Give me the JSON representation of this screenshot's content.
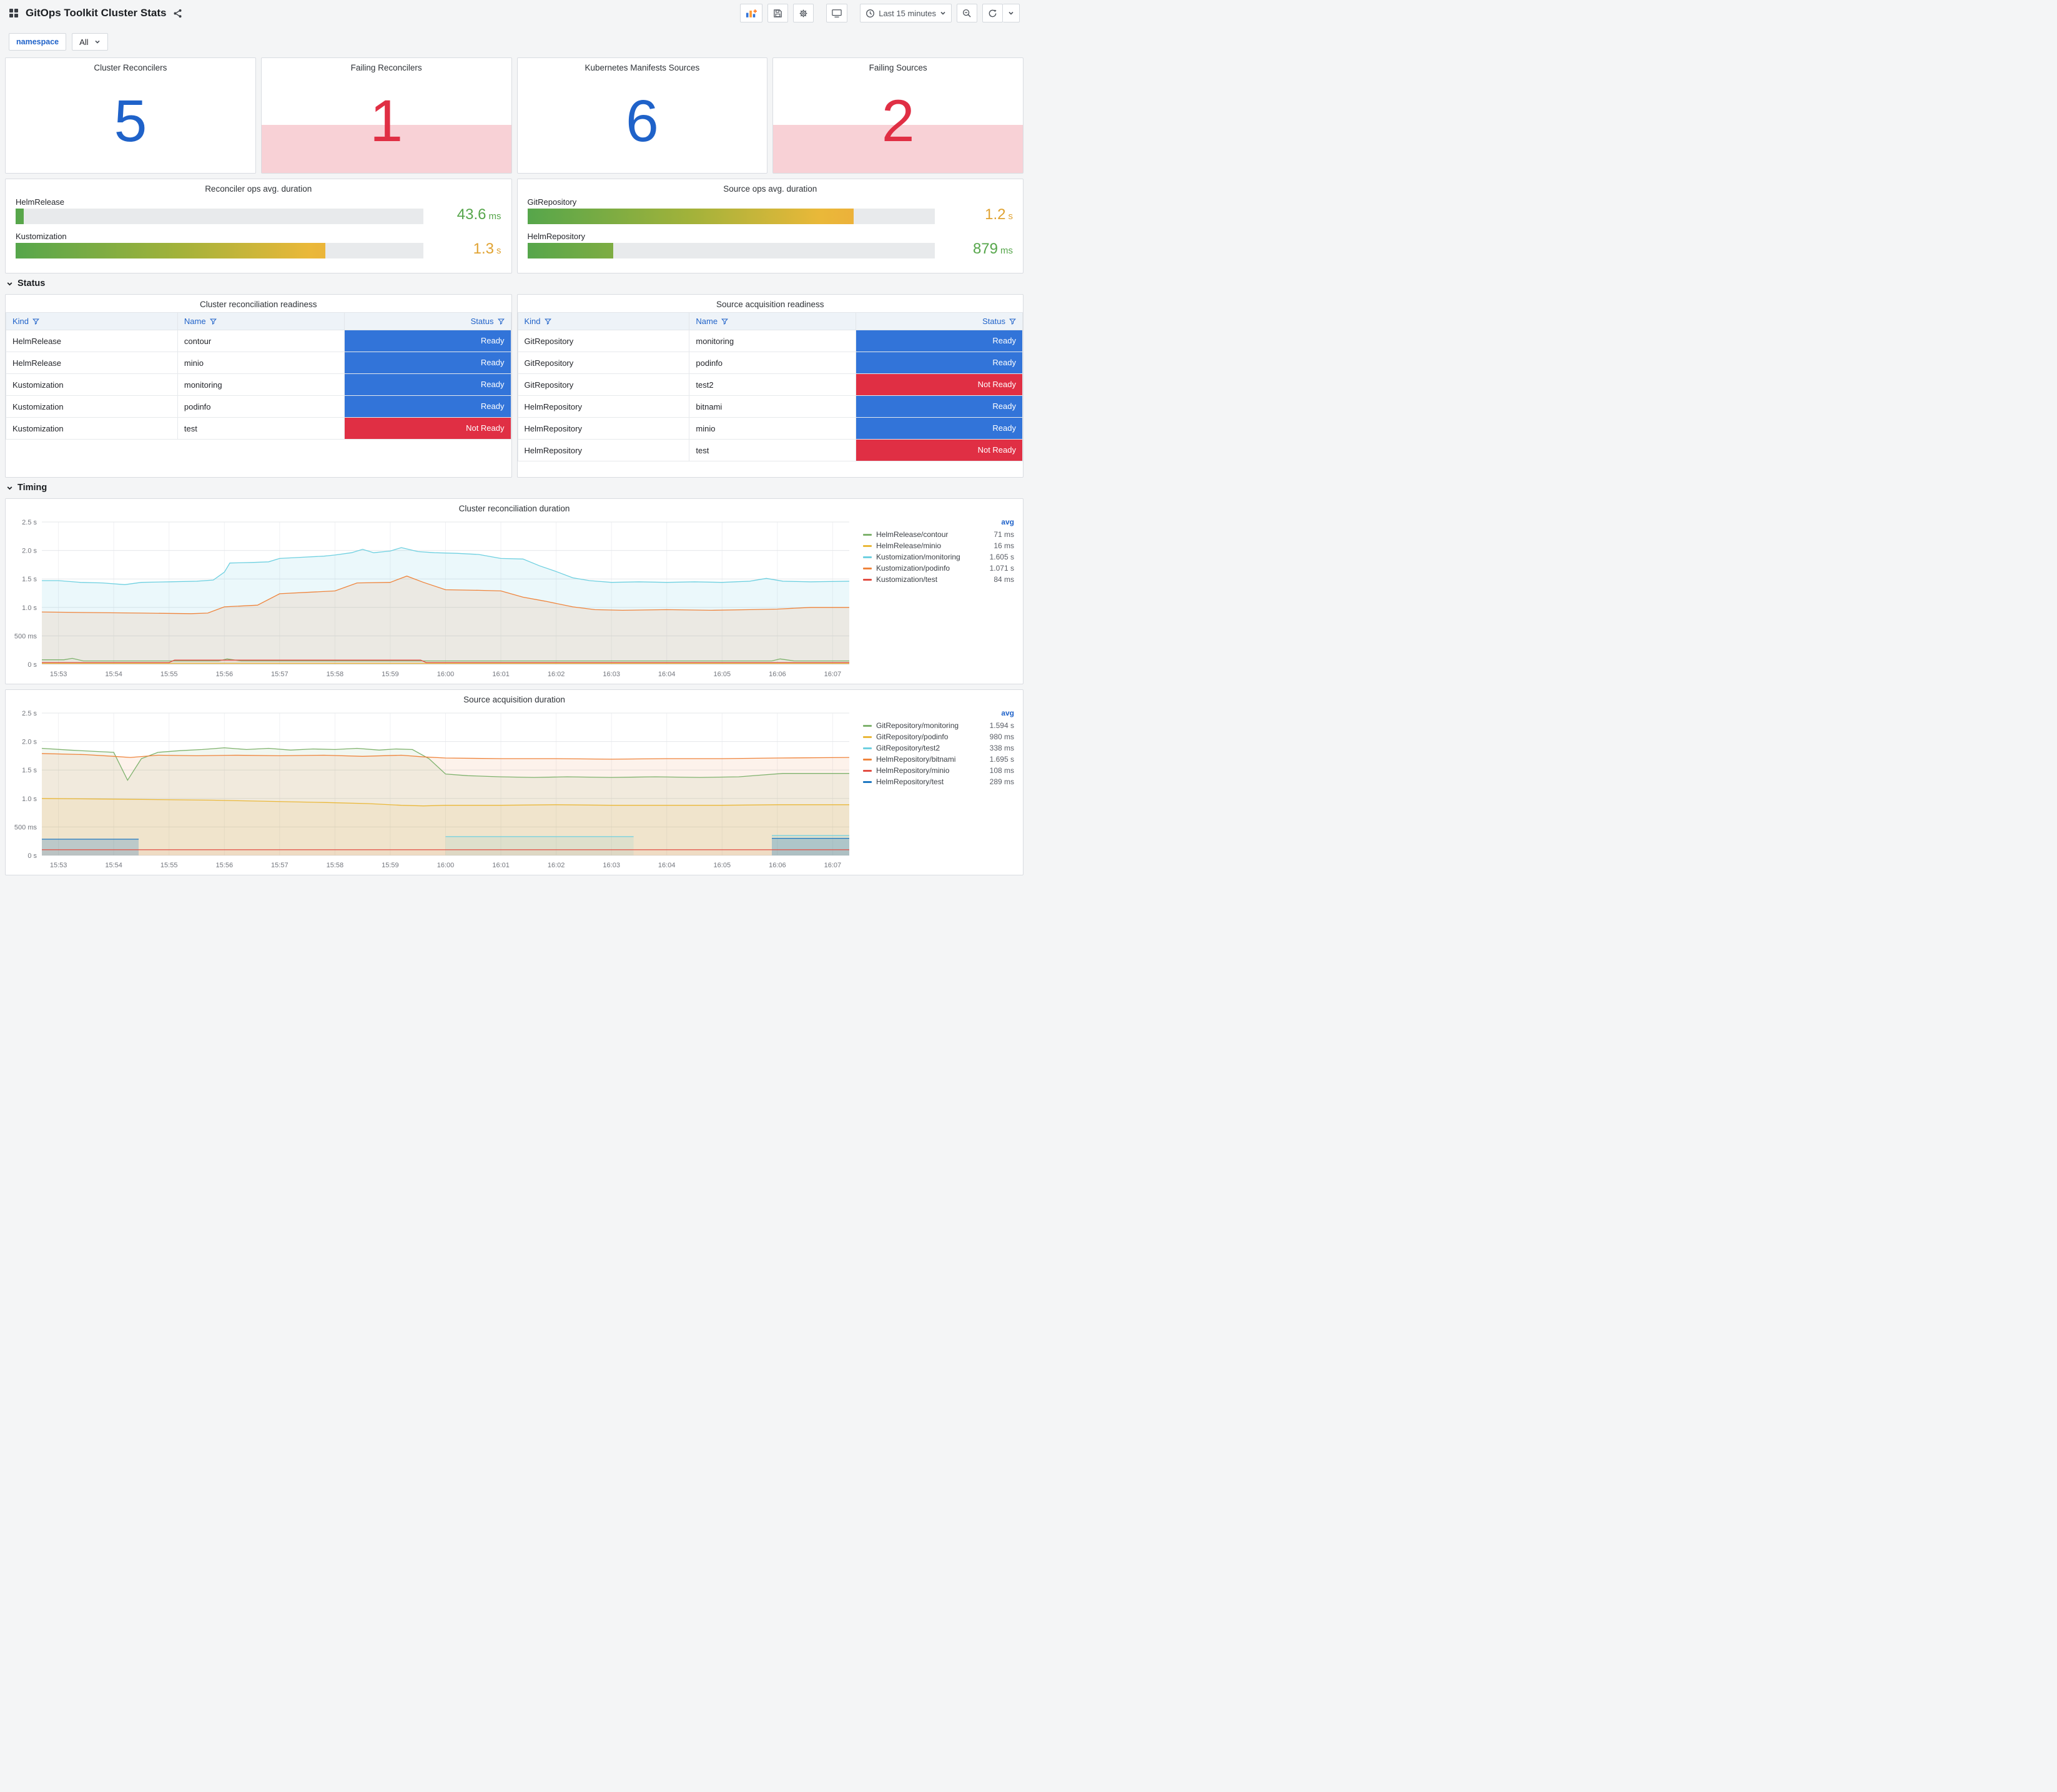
{
  "nav": {
    "title": "GitOps Toolkit Cluster Stats",
    "time_picker": "Last 15 minutes"
  },
  "variables": {
    "label": "namespace",
    "value": "All"
  },
  "sections": {
    "status": "Status",
    "timing": "Timing"
  },
  "stats": [
    {
      "title": "Cluster Reconcilers",
      "value": "5",
      "state": "ok"
    },
    {
      "title": "Failing Reconcilers",
      "value": "1",
      "state": "alert"
    },
    {
      "title": "Kubernetes Manifests Sources",
      "value": "6",
      "state": "ok"
    },
    {
      "title": "Failing Sources",
      "value": "2",
      "state": "alert"
    }
  ],
  "gauge_panels": [
    {
      "title": "Reconciler ops avg. duration",
      "rows": [
        {
          "label": "HelmRelease",
          "value": "43.6",
          "unit": "ms",
          "pct": 2,
          "value_color": "#56a64b"
        },
        {
          "label": "Kustomization",
          "value": "1.3",
          "unit": "s",
          "pct": 76,
          "value_color": "#e0a231"
        }
      ]
    },
    {
      "title": "Source ops avg. duration",
      "rows": [
        {
          "label": "GitRepository",
          "value": "1.2",
          "unit": "s",
          "pct": 80,
          "value_color": "#e0a231"
        },
        {
          "label": "HelmRepository",
          "value": "879",
          "unit": "ms",
          "pct": 21,
          "value_color": "#56a64b"
        }
      ]
    }
  ],
  "tables": [
    {
      "title": "Cluster reconciliation readiness",
      "headers": [
        "Kind",
        "Name",
        "Status"
      ],
      "rows": [
        {
          "kind": "HelmRelease",
          "name": "contour",
          "status": "Ready"
        },
        {
          "kind": "HelmRelease",
          "name": "minio",
          "status": "Ready"
        },
        {
          "kind": "Kustomization",
          "name": "monitoring",
          "status": "Ready"
        },
        {
          "kind": "Kustomization",
          "name": "podinfo",
          "status": "Ready"
        },
        {
          "kind": "Kustomization",
          "name": "test",
          "status": "Not Ready"
        }
      ]
    },
    {
      "title": "Source acquisition readiness",
      "headers": [
        "Kind",
        "Name",
        "Status"
      ],
      "rows": [
        {
          "kind": "GitRepository",
          "name": "monitoring",
          "status": "Ready"
        },
        {
          "kind": "GitRepository",
          "name": "podinfo",
          "status": "Ready"
        },
        {
          "kind": "GitRepository",
          "name": "test2",
          "status": "Not Ready"
        },
        {
          "kind": "HelmRepository",
          "name": "bitnami",
          "status": "Ready"
        },
        {
          "kind": "HelmRepository",
          "name": "minio",
          "status": "Ready"
        },
        {
          "kind": "HelmRepository",
          "name": "test",
          "status": "Not Ready"
        }
      ]
    }
  ],
  "chart_data": [
    {
      "type": "line",
      "title": "Cluster reconciliation duration",
      "x_ticks": [
        "15:53",
        "15:54",
        "15:55",
        "15:56",
        "15:57",
        "15:58",
        "15:59",
        "16:00",
        "16:01",
        "16:02",
        "16:03",
        "16:04",
        "16:05",
        "16:06",
        "16:07"
      ],
      "x_range": [
        -0.3,
        14.3
      ],
      "ylim": [
        0,
        2.5
      ],
      "y_ticks": [
        {
          "v": 0,
          "label": "0 s"
        },
        {
          "v": 0.5,
          "label": "500 ms"
        },
        {
          "v": 1,
          "label": "1.0 s"
        },
        {
          "v": 1.5,
          "label": "1.5 s"
        },
        {
          "v": 2,
          "label": "2.0 s"
        },
        {
          "v": 2.5,
          "label": "2.5 s"
        }
      ],
      "legend_header": "avg",
      "grid": true,
      "legend_position": "right",
      "series": [
        {
          "name": "HelmRelease/contour",
          "avg": "71 ms",
          "color": "#7EB26D",
          "fill": 0.05,
          "points": [
            [
              -0.3,
              0.08
            ],
            [
              0.1,
              0.08
            ],
            [
              0.25,
              0.105
            ],
            [
              0.45,
              0.06
            ],
            [
              1,
              0.06
            ],
            [
              2,
              0.06
            ],
            [
              2.9,
              0.06
            ],
            [
              3.05,
              0.095
            ],
            [
              3.3,
              0.06
            ],
            [
              4,
              0.06
            ],
            [
              5,
              0.06
            ],
            [
              6,
              0.06
            ],
            [
              7,
              0.06
            ],
            [
              8,
              0.06
            ],
            [
              9,
              0.06
            ],
            [
              10,
              0.06
            ],
            [
              11,
              0.06
            ],
            [
              12,
              0.06
            ],
            [
              12.9,
              0.06
            ],
            [
              13.05,
              0.095
            ],
            [
              13.3,
              0.06
            ],
            [
              14.3,
              0.06
            ]
          ]
        },
        {
          "name": "HelmRelease/minio",
          "avg": "16 ms",
          "color": "#EAB839",
          "fill": 0.04,
          "points": [
            [
              -0.3,
              0.018
            ],
            [
              14.3,
              0.018
            ]
          ]
        },
        {
          "name": "Kustomization/monitoring",
          "avg": "1.605 s",
          "color": "#6ED0E0",
          "fill": 0.14,
          "points": [
            [
              -0.3,
              1.47
            ],
            [
              0,
              1.47
            ],
            [
              0.4,
              1.44
            ],
            [
              0.8,
              1.43
            ],
            [
              1.2,
              1.4
            ],
            [
              1.5,
              1.44
            ],
            [
              2,
              1.45
            ],
            [
              2.5,
              1.46
            ],
            [
              2.8,
              1.48
            ],
            [
              3,
              1.62
            ],
            [
              3.1,
              1.78
            ],
            [
              3.5,
              1.79
            ],
            [
              3.8,
              1.8
            ],
            [
              4,
              1.86
            ],
            [
              4.4,
              1.88
            ],
            [
              4.8,
              1.9
            ],
            [
              5,
              1.92
            ],
            [
              5.3,
              1.96
            ],
            [
              5.5,
              2.02
            ],
            [
              5.7,
              1.96
            ],
            [
              6,
              1.99
            ],
            [
              6.2,
              2.05
            ],
            [
              6.5,
              1.98
            ],
            [
              6.8,
              1.96
            ],
            [
              7.2,
              1.95
            ],
            [
              7.6,
              1.93
            ],
            [
              8,
              1.86
            ],
            [
              8.4,
              1.85
            ],
            [
              8.7,
              1.73
            ],
            [
              9,
              1.63
            ],
            [
              9.3,
              1.52
            ],
            [
              9.6,
              1.47
            ],
            [
              10,
              1.44
            ],
            [
              10.5,
              1.45
            ],
            [
              11,
              1.44
            ],
            [
              11.5,
              1.45
            ],
            [
              12,
              1.44
            ],
            [
              12.5,
              1.46
            ],
            [
              12.8,
              1.51
            ],
            [
              13.1,
              1.46
            ],
            [
              13.6,
              1.45
            ],
            [
              14.3,
              1.46
            ]
          ]
        },
        {
          "name": "Kustomization/podinfo",
          "avg": "1.071 s",
          "color": "#EF843C",
          "fill": 0.12,
          "points": [
            [
              -0.3,
              0.92
            ],
            [
              0.5,
              0.91
            ],
            [
              1.5,
              0.9
            ],
            [
              2.4,
              0.89
            ],
            [
              2.7,
              0.9
            ],
            [
              3,
              1.01
            ],
            [
              3.6,
              1.04
            ],
            [
              4,
              1.24
            ],
            [
              4.6,
              1.27
            ],
            [
              5,
              1.29
            ],
            [
              5.4,
              1.43
            ],
            [
              6,
              1.44
            ],
            [
              6.3,
              1.55
            ],
            [
              6.6,
              1.44
            ],
            [
              7,
              1.31
            ],
            [
              7.6,
              1.3
            ],
            [
              8,
              1.29
            ],
            [
              8.4,
              1.18
            ],
            [
              8.8,
              1.11
            ],
            [
              9.3,
              1.01
            ],
            [
              9.7,
              0.96
            ],
            [
              10.2,
              0.95
            ],
            [
              11,
              0.96
            ],
            [
              11.8,
              0.95
            ],
            [
              12.5,
              0.96
            ],
            [
              13,
              0.97
            ],
            [
              13.6,
              1.0
            ],
            [
              14.3,
              1.0
            ]
          ]
        },
        {
          "name": "Kustomization/test",
          "avg": "84 ms",
          "color": "#E24D42",
          "fill": 0.05,
          "points": [
            [
              -0.3,
              0.032
            ],
            [
              2,
              0.032
            ],
            [
              2.1,
              0.075
            ],
            [
              6.55,
              0.075
            ],
            [
              6.65,
              0.032
            ],
            [
              14.3,
              0.032
            ]
          ]
        }
      ]
    },
    {
      "type": "line",
      "title": "Source acquisition duration",
      "x_ticks": [
        "15:53",
        "15:54",
        "15:55",
        "15:56",
        "15:57",
        "15:58",
        "15:59",
        "16:00",
        "16:01",
        "16:02",
        "16:03",
        "16:04",
        "16:05",
        "16:06",
        "16:07"
      ],
      "x_range": [
        -0.3,
        14.3
      ],
      "ylim": [
        0,
        2.5
      ],
      "y_ticks": [
        {
          "v": 0,
          "label": "0 s"
        },
        {
          "v": 0.5,
          "label": "500 ms"
        },
        {
          "v": 1,
          "label": "1.0 s"
        },
        {
          "v": 1.5,
          "label": "1.5 s"
        },
        {
          "v": 2,
          "label": "2.0 s"
        },
        {
          "v": 2.5,
          "label": "2.5 s"
        }
      ],
      "legend_header": "avg",
      "grid": true,
      "legend_position": "right",
      "series": [
        {
          "name": "GitRepository/monitoring",
          "avg": "1.594 s",
          "color": "#7EB26D",
          "fill": 0.1,
          "points": [
            [
              -0.3,
              1.88
            ],
            [
              0.2,
              1.85
            ],
            [
              0.6,
              1.83
            ],
            [
              1,
              1.81
            ],
            [
              1.25,
              1.32
            ],
            [
              1.5,
              1.7
            ],
            [
              1.8,
              1.81
            ],
            [
              2.2,
              1.84
            ],
            [
              2.6,
              1.86
            ],
            [
              3,
              1.89
            ],
            [
              3.4,
              1.86
            ],
            [
              3.8,
              1.88
            ],
            [
              4.2,
              1.85
            ],
            [
              4.6,
              1.87
            ],
            [
              5,
              1.86
            ],
            [
              5.4,
              1.88
            ],
            [
              5.8,
              1.85
            ],
            [
              6.1,
              1.87
            ],
            [
              6.4,
              1.86
            ],
            [
              6.7,
              1.7
            ],
            [
              7,
              1.43
            ],
            [
              7.4,
              1.4
            ],
            [
              8,
              1.38
            ],
            [
              8.6,
              1.37
            ],
            [
              9.2,
              1.38
            ],
            [
              10,
              1.37
            ],
            [
              10.8,
              1.38
            ],
            [
              11.6,
              1.37
            ],
            [
              12.3,
              1.38
            ],
            [
              12.7,
              1.41
            ],
            [
              13.1,
              1.44
            ],
            [
              14.3,
              1.44
            ]
          ]
        },
        {
          "name": "GitRepository/podinfo",
          "avg": "980 ms",
          "color": "#EAB839",
          "fill": 0.1,
          "points": [
            [
              -0.3,
              1.0
            ],
            [
              0.8,
              0.99
            ],
            [
              1.8,
              0.98
            ],
            [
              2.8,
              0.97
            ],
            [
              3.8,
              0.95
            ],
            [
              4.8,
              0.93
            ],
            [
              5.6,
              0.91
            ],
            [
              6.2,
              0.88
            ],
            [
              6.6,
              0.87
            ],
            [
              7,
              0.88
            ],
            [
              8,
              0.88
            ],
            [
              9,
              0.89
            ],
            [
              10,
              0.88
            ],
            [
              11,
              0.88
            ],
            [
              12,
              0.88
            ],
            [
              13,
              0.89
            ],
            [
              14.3,
              0.89
            ]
          ]
        },
        {
          "name": "GitRepository/test2",
          "avg": "338 ms",
          "color": "#6ED0E0",
          "fill": 0.15,
          "points": [
            [
              7,
              0.33
            ],
            [
              10.4,
              0.33
            ],
            [
              10.45,
              null
            ],
            [
              12.9,
              0.35
            ],
            [
              14.3,
              0.35
            ]
          ]
        },
        {
          "name": "HelmRepository/bitnami",
          "avg": "1.695 s",
          "color": "#EF843C",
          "fill": 0.1,
          "points": [
            [
              -0.3,
              1.79
            ],
            [
              0.5,
              1.77
            ],
            [
              1,
              1.74
            ],
            [
              1.3,
              1.72
            ],
            [
              1.8,
              1.76
            ],
            [
              2.5,
              1.75
            ],
            [
              3.2,
              1.76
            ],
            [
              4,
              1.75
            ],
            [
              4.8,
              1.76
            ],
            [
              5.5,
              1.74
            ],
            [
              6.2,
              1.76
            ],
            [
              6.6,
              1.73
            ],
            [
              7,
              1.71
            ],
            [
              8,
              1.7
            ],
            [
              9,
              1.7
            ],
            [
              10,
              1.69
            ],
            [
              11,
              1.7
            ],
            [
              12,
              1.7
            ],
            [
              13,
              1.71
            ],
            [
              14.3,
              1.72
            ]
          ]
        },
        {
          "name": "HelmRepository/minio",
          "avg": "108 ms",
          "color": "#E24D42",
          "fill": 0.05,
          "points": [
            [
              -0.3,
              0.1
            ],
            [
              14.3,
              0.1
            ]
          ]
        },
        {
          "name": "HelmRepository/test",
          "avg": "289 ms",
          "color": "#1F78C1",
          "fill": 0.25,
          "points": [
            [
              -0.3,
              0.285
            ],
            [
              1.45,
              0.285
            ],
            [
              1.5,
              null
            ],
            [
              12.9,
              0.3
            ],
            [
              14.3,
              0.3
            ]
          ]
        }
      ]
    }
  ],
  "colors": {
    "stat_ok": "#1f62c9",
    "stat_alert": "#e02f44",
    "alert_bg": "rgba(224,47,68,0.22)",
    "ready": "#3274d9",
    "not_ready": "#e02f44",
    "link": "#1f62c9",
    "gauge_track": "#e8eaec",
    "gauge_gradient": [
      "#56a64b",
      "#a2b23a",
      "#eab839",
      "#f0a13c"
    ]
  },
  "icons": {
    "apps-icon": "grid",
    "share-icon": "share-alt",
    "add-panel-icon": "graph-plus",
    "save-icon": "floppy-disk",
    "settings-icon": "gear",
    "tv-icon": "monitor",
    "clock-icon": "clock",
    "chevron-down-icon": "chevron-down",
    "zoom-out-icon": "magnifier-minus",
    "refresh-icon": "circular-arrow",
    "filter-icon": "funnel",
    "collapse-icon": "chevron-down"
  }
}
